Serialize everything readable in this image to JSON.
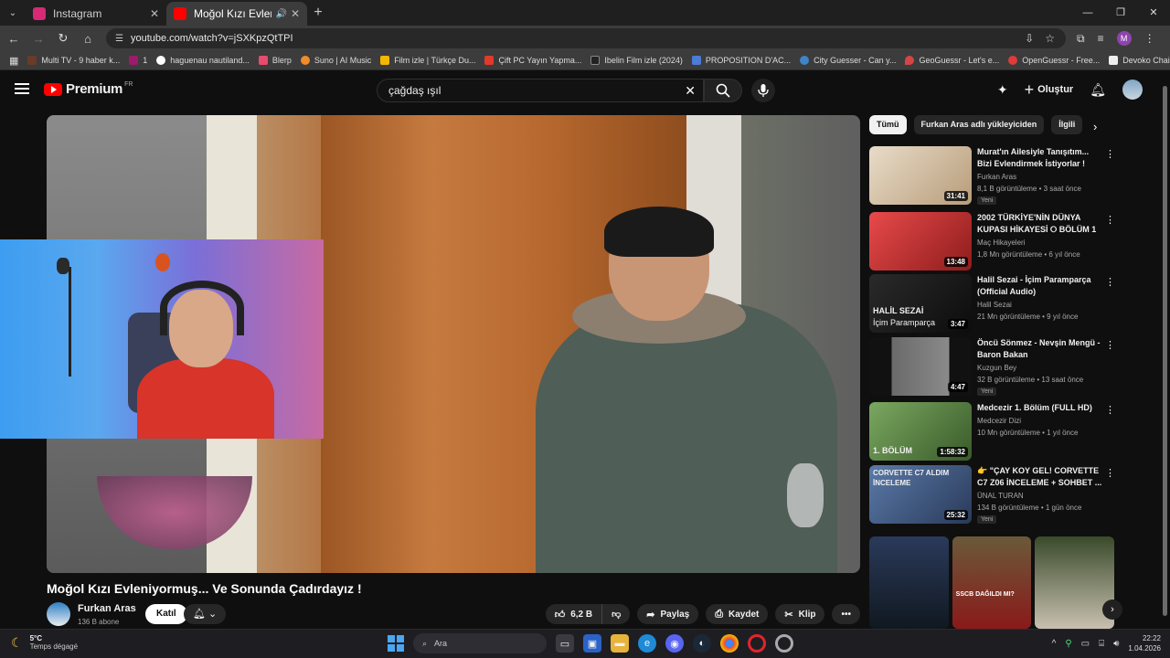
{
  "browser": {
    "tabs": [
      {
        "title": "Instagram",
        "favicon_color": "#d62976",
        "active": false
      },
      {
        "title": "Moğol Kızı Evleniyormuş... V",
        "favicon_color": "#ff0000",
        "active": true
      }
    ],
    "url": "youtube.com/watch?v=jSXKpzQtTPI",
    "profile_initial": "M",
    "bookmarks": [
      {
        "label": "Multi TV - 9 haber k...",
        "color": "#6b3b2a"
      },
      {
        "label": "1",
        "color": "#9b1c6a"
      },
      {
        "label": "haguenau nautiland...",
        "color": "#ffffff"
      },
      {
        "label": "Blerp",
        "color": "#e84b6b"
      },
      {
        "label": "Suno | AI Music",
        "color": "#f08c2a"
      },
      {
        "label": "Film izle | Türkçe Du...",
        "color": "#f5b800"
      },
      {
        "label": "Çift PC Yayın Yapma...",
        "color": "#e23a2a"
      },
      {
        "label": "Ibelin Film izle (2024)",
        "color": "#222222"
      },
      {
        "label": "PROPOSITION D'AC...",
        "color": "#4a7cd8"
      },
      {
        "label": "City Guesser - Can y...",
        "color": "#3d85c6"
      },
      {
        "label": "GeoGuessr - Let's e...",
        "color": "#d64545"
      },
      {
        "label": "OpenGuessr - Free...",
        "color": "#e03a3a"
      },
      {
        "label": "Devoko Chaise de G...",
        "color": "#eeeeee"
      }
    ]
  },
  "youtube": {
    "logo_text": "Premium",
    "region": "FR",
    "search_query": "çağdaş ışıl",
    "create_label": "Oluştur",
    "video": {
      "title": "Moğol Kızı Evleniyormuş... Ve Sonunda Çadırdayız !",
      "channel": "Furkan Aras",
      "subscribers": "136 B abone",
      "join_label": "Katıl",
      "likes": "6,2 B",
      "share_label": "Paylaş",
      "save_label": "Kaydet",
      "clip_label": "Klip"
    },
    "chips": [
      "Tümü",
      "Furkan Aras adlı yükleyiciden",
      "İlgili"
    ],
    "recommendations": [
      {
        "title": "Murat'ın Ailesiyle Tanışıtım... Bizi Evlendirmek İstiyorlar !",
        "channel": "Furkan Aras",
        "meta": "8,1 B görüntüleme • 3 saat önce",
        "badge": "Yeni",
        "duration": "31:41",
        "thumb": "#d8c8b0"
      },
      {
        "title": "2002 TÜRKİYE'NİN DÜNYA KUPASI HİKAYESİ ⭘ BÖLÜM 1",
        "channel": "Maç Hikayeleri",
        "meta": "1,8 Mn görüntüleme • 6 yıl önce",
        "badge": "",
        "duration": "13:48",
        "thumb": "#d63a3a"
      },
      {
        "title": "Halil Sezai - İçim Paramparça (Official Audio)",
        "channel": "Halil Sezai",
        "meta": "21 Mn görüntüleme • 9 yıl önce",
        "badge": "",
        "duration": "3:47",
        "thumb": "#1e1e1e"
      },
      {
        "title": "Öncü Sönmez - Nevşin Mengü - Baron Bakan",
        "channel": "Kuzgun Bey",
        "meta": "32 B görüntüleme • 13 saat önce",
        "badge": "Yeni",
        "duration": "4:47",
        "thumb": "#3a3a3a"
      },
      {
        "title": "Medcezir 1. Bölüm (FULL HD)",
        "channel": "Medcezir Dizi",
        "meta": "10 Mn görüntüleme • 1 yıl önce",
        "badge": "",
        "duration": "1:58:32",
        "thumb": "#5a8a4a"
      },
      {
        "title": "👉 \"ÇAY KOY GEL! CORVETTE C7 Z06 İNCELEME + SOHBET ...",
        "channel": "ÜNAL TURAN",
        "meta": "134 B görüntüleme • 1 gün önce",
        "badge": "Yeni",
        "duration": "25:32",
        "thumb": "#4a6a9a"
      }
    ],
    "thumb_labels": {
      "halil": "HALİL SEZAİ",
      "halil2": "İçim Paramparça",
      "medcezir": "1. BÖLÜM",
      "corvette": "CORVETTE C7 ALDIM",
      "corvette2": "İNCELEME",
      "shelf_caption": "SSCB DAĞILDI MI?"
    }
  },
  "taskbar": {
    "temperature": "5°C",
    "weather": "Temps dégagé",
    "search_placeholder": "Ara",
    "time": "22:22",
    "date": "1.04.2026"
  }
}
